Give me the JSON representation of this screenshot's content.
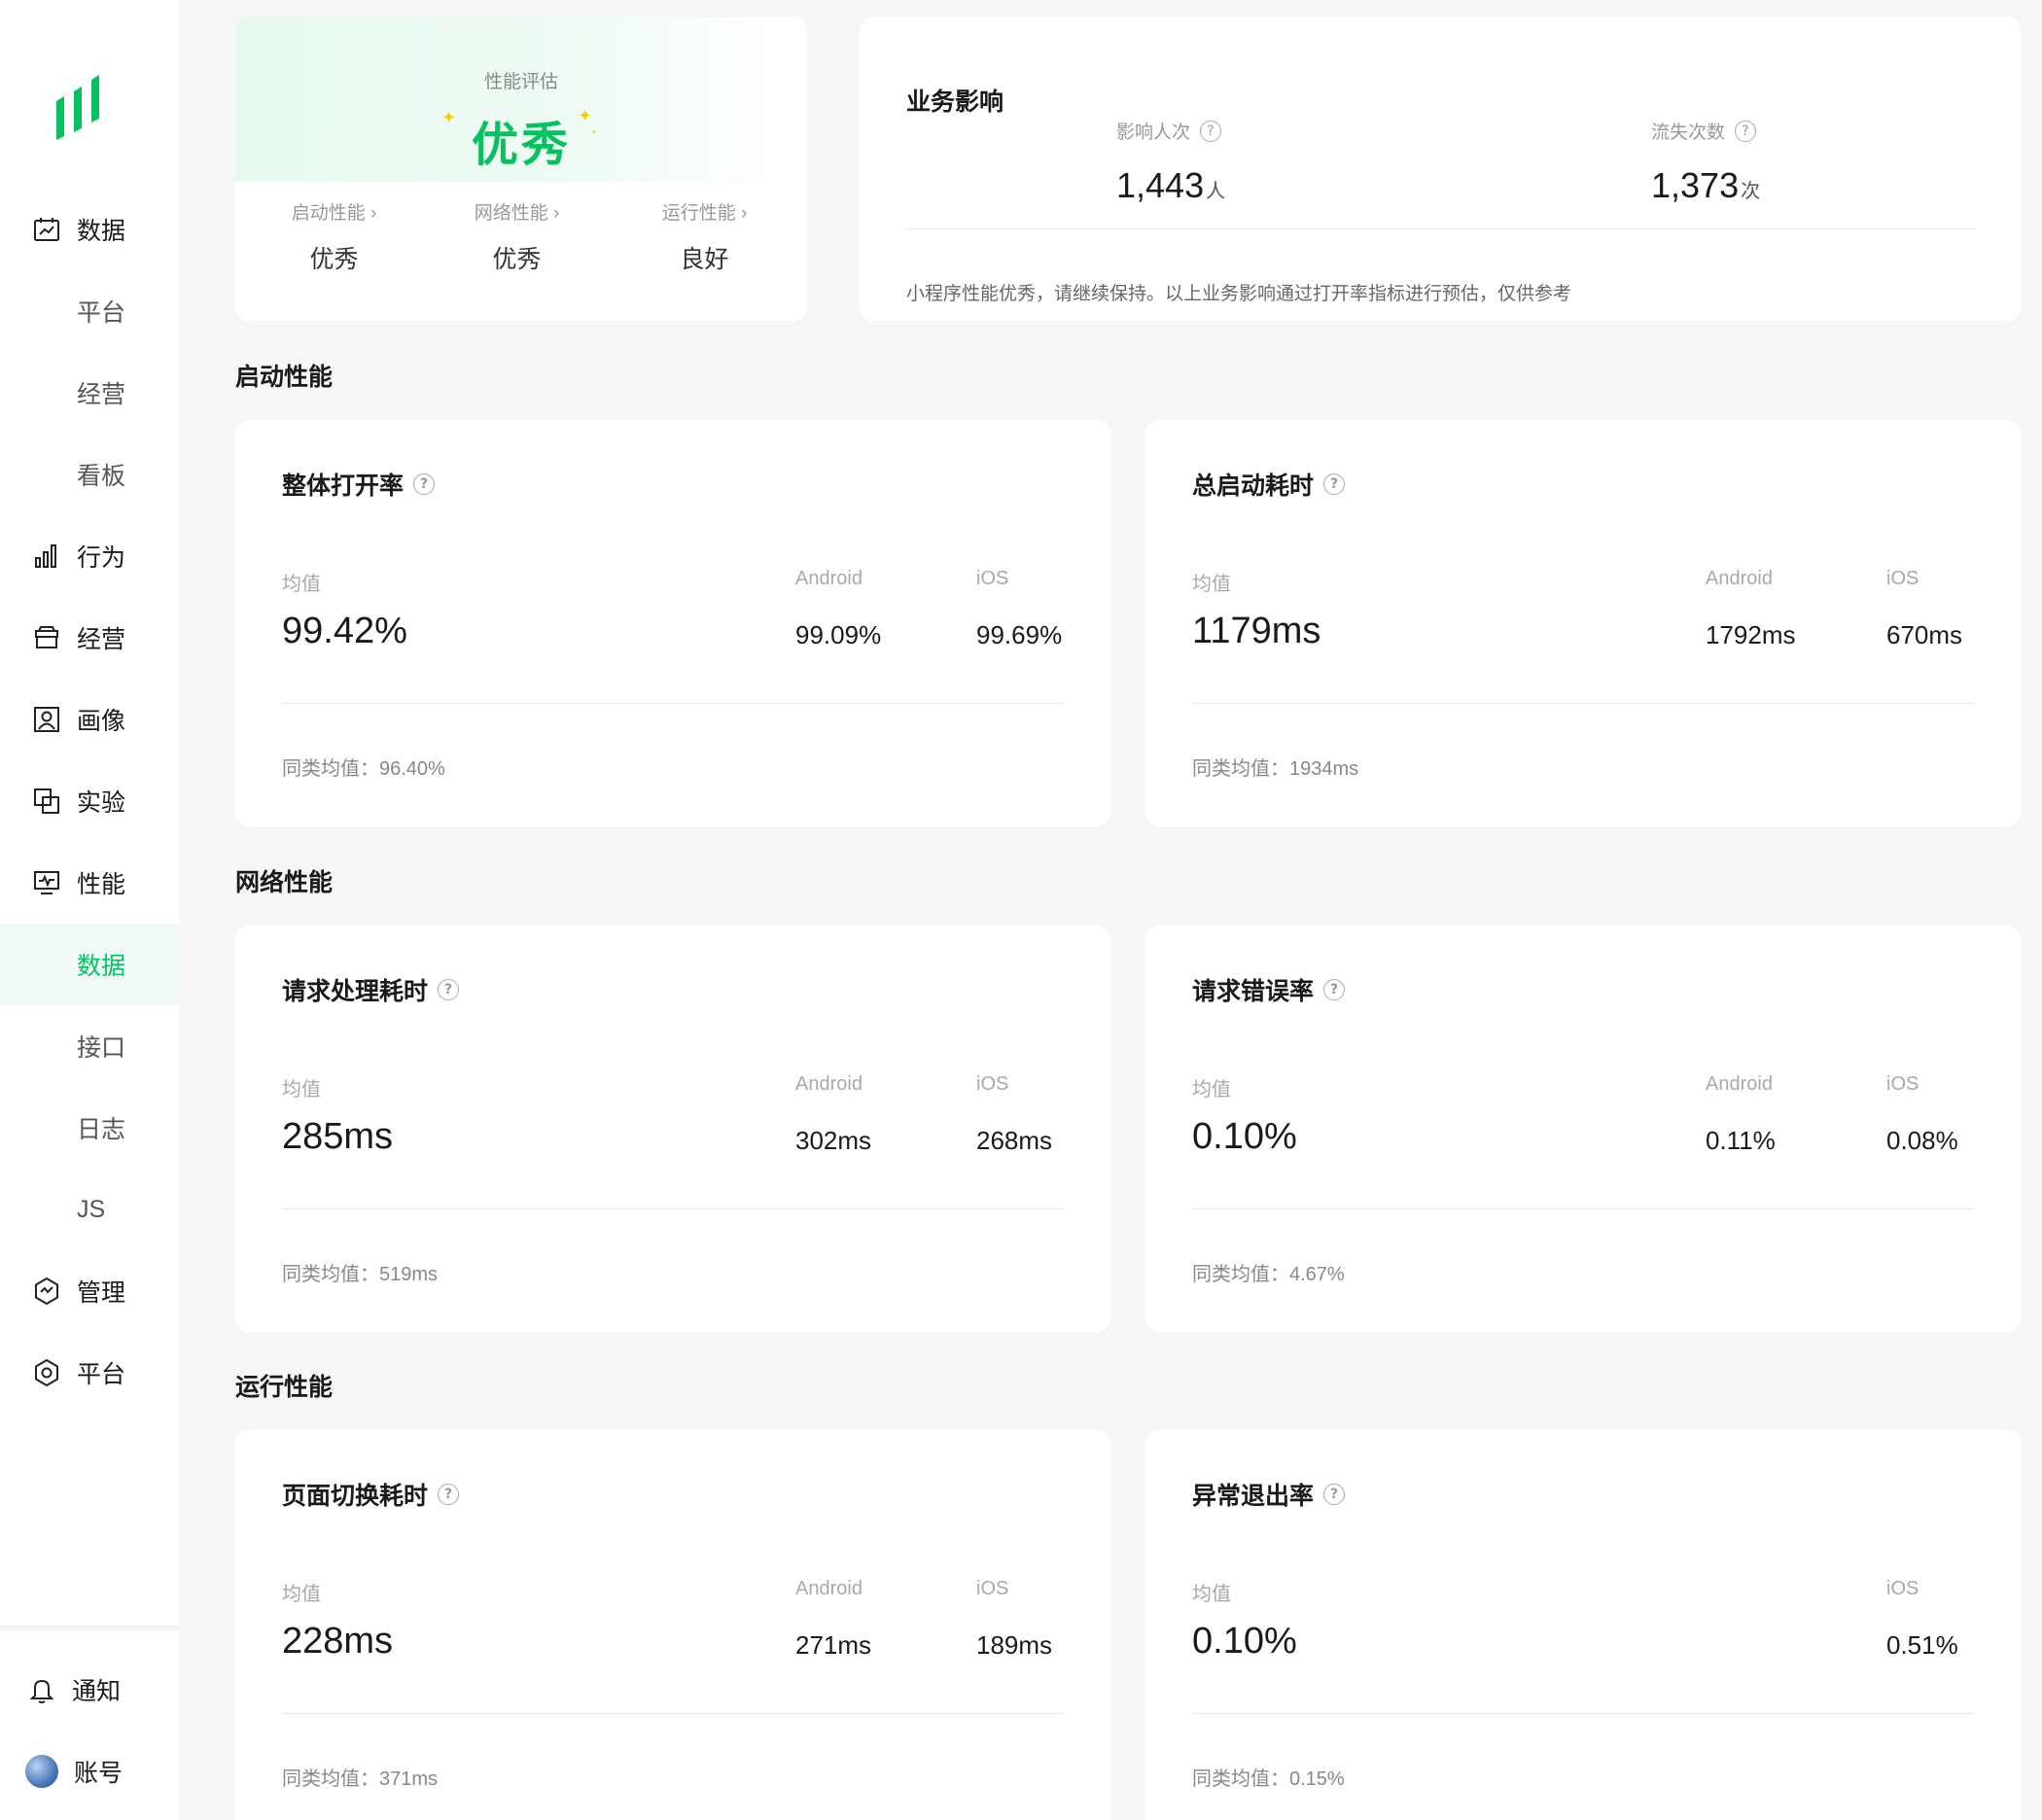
{
  "sidebar": {
    "items": [
      {
        "label": "数据",
        "icon": "chart-line-icon",
        "type": "main"
      },
      {
        "label": "平台",
        "type": "sub"
      },
      {
        "label": "经营",
        "type": "sub"
      },
      {
        "label": "看板",
        "type": "sub"
      },
      {
        "label": "行为",
        "icon": "bar-chart-icon",
        "type": "main"
      },
      {
        "label": "经营",
        "icon": "storefront-icon",
        "type": "main"
      },
      {
        "label": "画像",
        "icon": "user-portrait-icon",
        "type": "main"
      },
      {
        "label": "实验",
        "icon": "experiment-icon",
        "type": "main"
      },
      {
        "label": "性能",
        "icon": "monitor-icon",
        "type": "main"
      },
      {
        "label": "数据",
        "type": "sub",
        "active": true
      },
      {
        "label": "接口",
        "type": "sub"
      },
      {
        "label": "日志",
        "type": "sub"
      },
      {
        "label": "JS",
        "type": "sub"
      },
      {
        "label": "管理",
        "icon": "hexagon-pulse-icon",
        "type": "main"
      },
      {
        "label": "平台",
        "icon": "hexagon-gear-icon",
        "type": "main"
      }
    ],
    "bottom": [
      {
        "label": "通知",
        "icon": "bell-icon"
      },
      {
        "label": "账号",
        "icon": "avatar"
      }
    ]
  },
  "summary": {
    "label": "性能评估",
    "rating": "优秀",
    "cols": [
      {
        "title": "启动性能 ›",
        "value": "优秀"
      },
      {
        "title": "网络性能 ›",
        "value": "优秀"
      },
      {
        "title": "运行性能 ›",
        "value": "良好"
      }
    ]
  },
  "impact": {
    "title": "业务影响",
    "affected_label": "影响人次",
    "affected_value": "1,443",
    "affected_unit": "人",
    "lost_label": "流失次数",
    "lost_value": "1,373",
    "lost_unit": "次",
    "note": "小程序性能优秀，请继续保持。以上业务影响通过打开率指标进行预估，仅供参考"
  },
  "sections": {
    "startup": "启动性能",
    "network": "网络性能",
    "runtime": "运行性能"
  },
  "labels": {
    "avg": "均值",
    "android": "Android",
    "ios": "iOS"
  },
  "cards": {
    "open_rate": {
      "title": "整体打开率",
      "avg": "99.42%",
      "android": "99.09%",
      "ios": "99.69%",
      "peer": "同类均值：96.40%"
    },
    "launch_time": {
      "title": "总启动耗时",
      "avg": "1179ms",
      "android": "1792ms",
      "ios": "670ms",
      "peer": "同类均值：1934ms"
    },
    "request_time": {
      "title": "请求处理耗时",
      "avg": "285ms",
      "android": "302ms",
      "ios": "268ms",
      "peer": "同类均值：519ms"
    },
    "request_error": {
      "title": "请求错误率",
      "avg": "0.10%",
      "android": "0.11%",
      "ios": "0.08%",
      "peer": "同类均值：4.67%"
    },
    "page_switch": {
      "title": "页面切换耗时",
      "avg": "228ms",
      "android": "271ms",
      "ios": "189ms",
      "peer": "同类均值：371ms"
    },
    "crash_rate": {
      "title": "异常退出率",
      "avg": "0.10%",
      "ios": "0.51%",
      "peer": "同类均值：0.15%"
    }
  },
  "colors": {
    "accent": "#07c160",
    "background": "#f6f6f6",
    "card": "#ffffff"
  }
}
